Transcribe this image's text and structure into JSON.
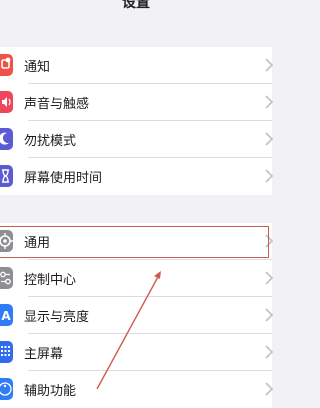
{
  "header": {
    "title": "设置"
  },
  "group1": {
    "items": [
      {
        "label": "通知",
        "icon": "notifications-icon",
        "color": "#f05247"
      },
      {
        "label": "声音与触感",
        "icon": "sounds-icon",
        "color": "#f0465b"
      },
      {
        "label": "勿扰模式",
        "icon": "moon-icon",
        "color": "#5c5bd3"
      },
      {
        "label": "屏幕使用时间",
        "icon": "hourglass-icon",
        "color": "#5c5bd3"
      }
    ]
  },
  "group2": {
    "items": [
      {
        "label": "通用",
        "icon": "gear-icon",
        "color": "#8e8e93"
      },
      {
        "label": "控制中心",
        "icon": "control-center-icon",
        "color": "#8e8e93"
      },
      {
        "label": "显示与亮度",
        "icon": "display-icon",
        "color": "#2f7cf6"
      },
      {
        "label": "主屏幕",
        "icon": "home-screen-icon",
        "color": "#2f6cf0"
      },
      {
        "label": "辅助功能",
        "icon": "accessibility-icon",
        "color": "#2f7cf6"
      }
    ]
  },
  "annotation": {
    "highlight_color": "#cf5a4f"
  }
}
